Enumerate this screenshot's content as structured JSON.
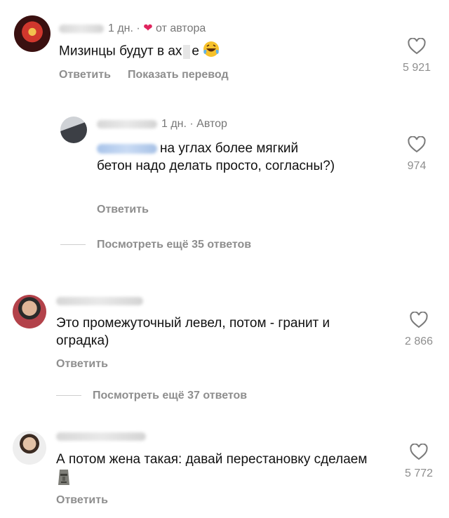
{
  "comments": [
    {
      "time": "1 дн. ·",
      "author_badge": "от автора",
      "text": "Мизинцы будут в ах",
      "text_tail": "е",
      "actions": [
        "Ответить",
        "Показать перевод"
      ],
      "likes": "5 921",
      "emoji_icon": "laughing-tears-emoji"
    },
    {
      "time": "1 дн. · Автор",
      "text_line1": "на углах более мягкий",
      "text_rest": "бетон надо делать просто, согласны?)",
      "actions": [
        "Ответить"
      ],
      "likes": "974",
      "more_replies": "Посмотреть ещё 35 ответов"
    },
    {
      "text": "Это промежуточный левел, потом - гранит и оградка)",
      "actions": [
        "Ответить"
      ],
      "likes": "2 866",
      "more_replies": "Посмотреть ещё 37 ответов"
    },
    {
      "text": "А потом жена такая: давай перестановку сделаем",
      "actions": [
        "Ответить"
      ],
      "likes": "5 772",
      "emoji_icon": "moai-emoji"
    }
  ],
  "colors": {
    "heart_accent": "#e0245e",
    "secondary_text": "#8e8e8e",
    "mention": "#a9c4ea"
  }
}
